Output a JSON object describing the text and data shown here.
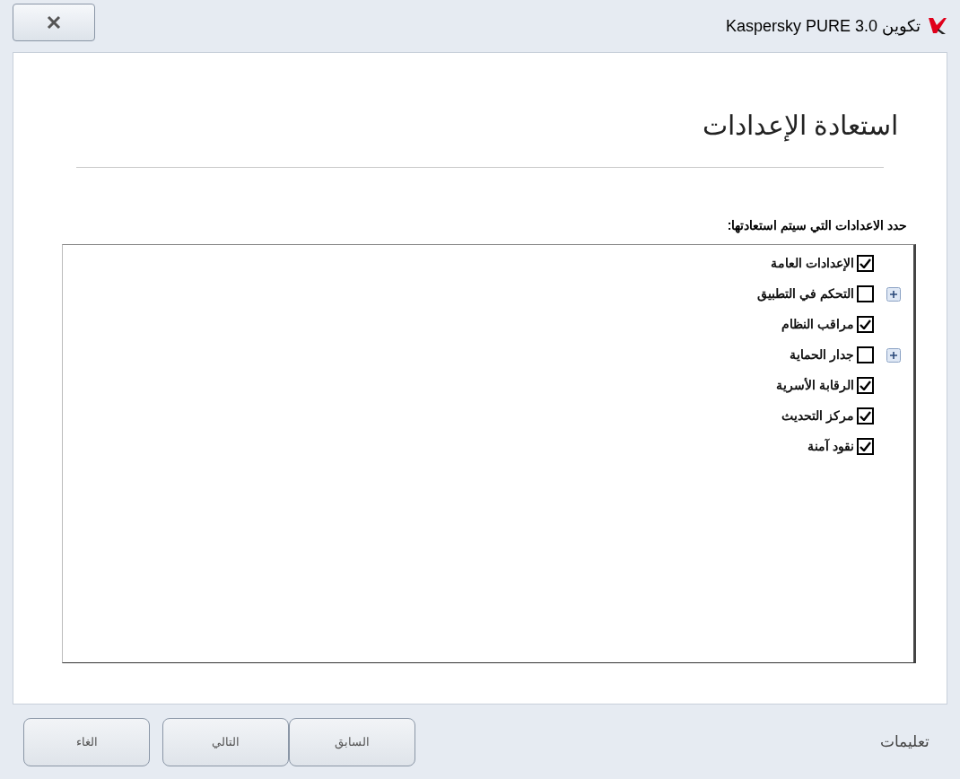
{
  "window": {
    "title": "تكوين Kaspersky PURE 3.0"
  },
  "heading": "استعادة الإعدادات",
  "prompt": "حدد الاعدادات التي سيتم استعادتها:",
  "tree": [
    {
      "label": "الإعدادات العامة",
      "checked": true
    },
    {
      "label": "التحكم في التطبيق",
      "checked": false,
      "expanded": false
    },
    {
      "label": "مراقب النظام",
      "checked": true
    },
    {
      "label": "جدار الحماية",
      "checked": false,
      "expanded": false
    },
    {
      "label": "الرقابة الأسرية",
      "checked": true
    },
    {
      "label": "مركز التحديث",
      "checked": true
    },
    {
      "label": "نقود آمنة",
      "checked": true
    }
  ],
  "footer": {
    "help": "تعليمات",
    "buttons": [
      "السابق",
      "التالي",
      "الغاء"
    ]
  }
}
